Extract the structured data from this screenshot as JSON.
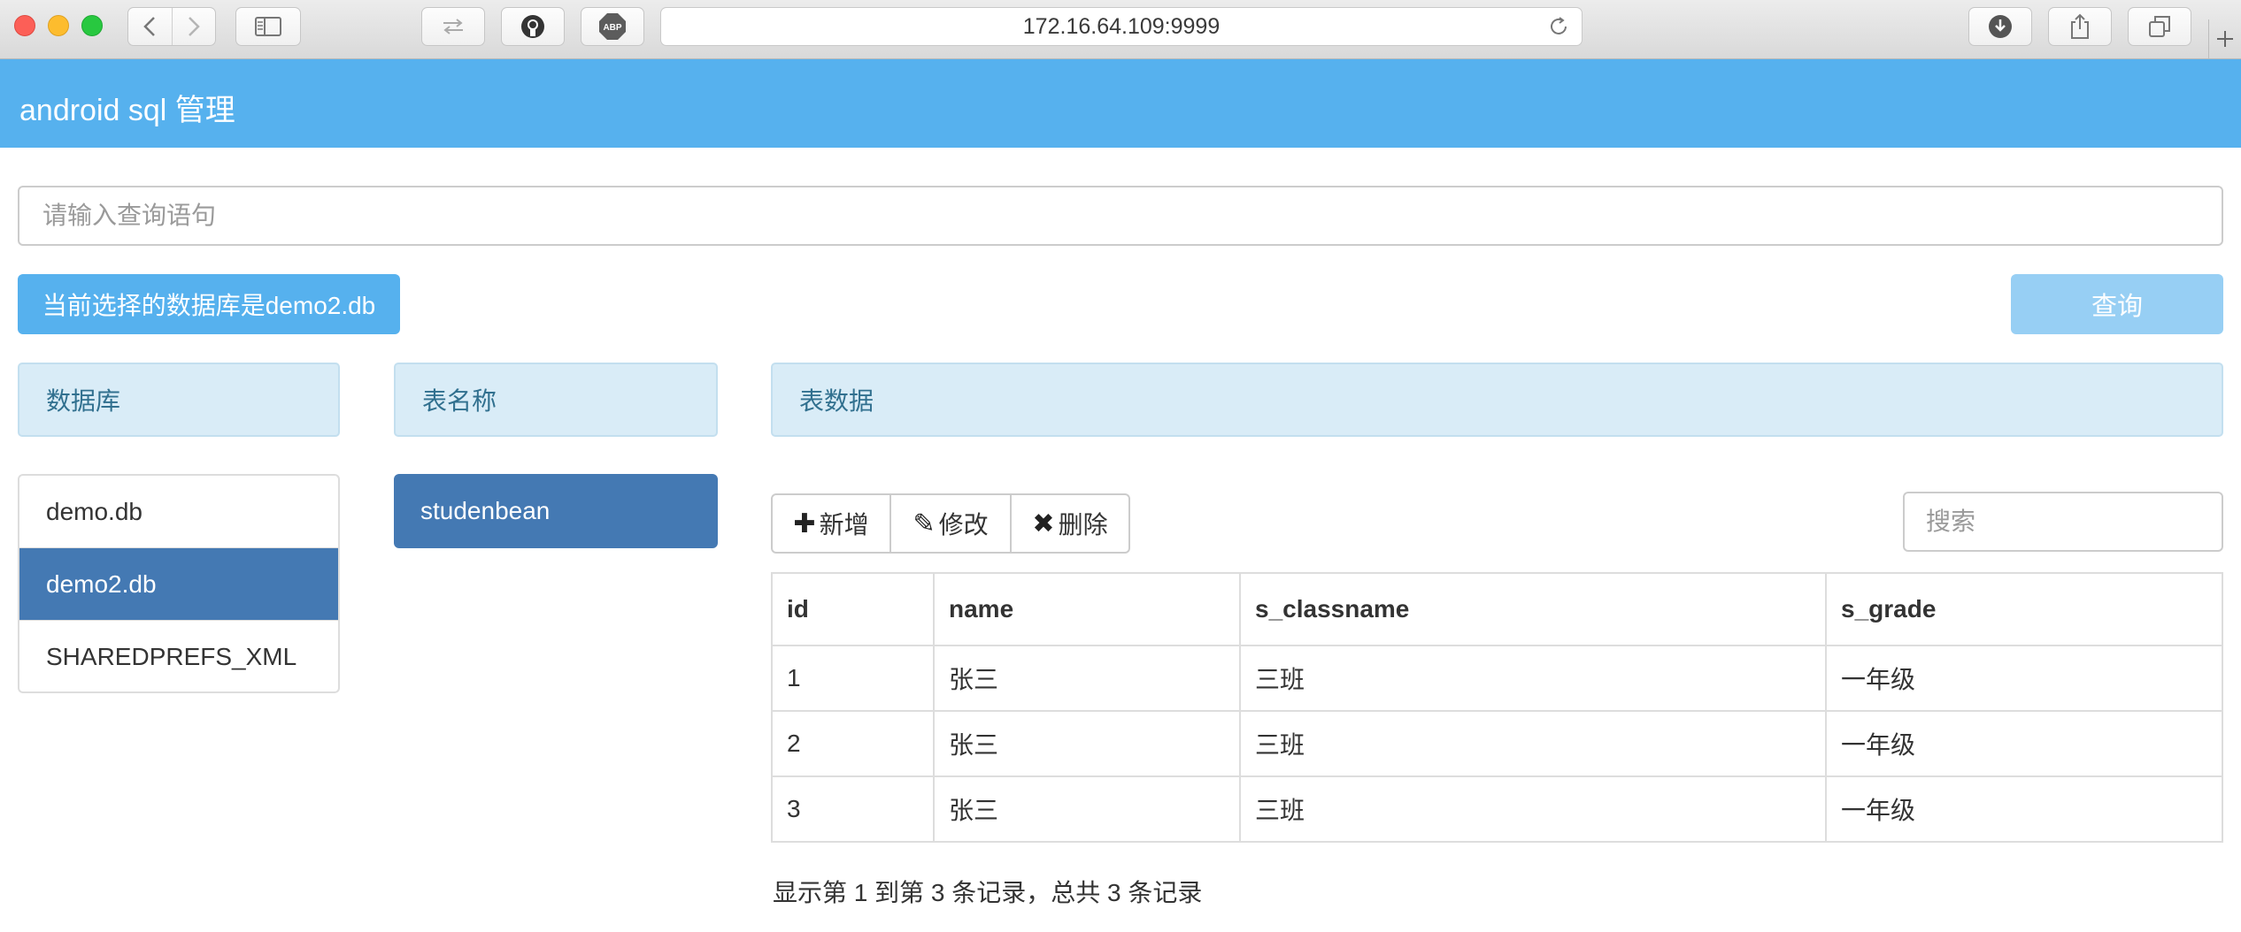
{
  "browser": {
    "url": "172.16.64.109:9999"
  },
  "app": {
    "title": "android sql 管理"
  },
  "query": {
    "placeholder": "请输入查询语句",
    "current_db_text": "当前选择的数据库是demo2.db",
    "button_label": "查询"
  },
  "panels": {
    "databases_header": "数据库",
    "tables_header": "表名称",
    "data_header": "表数据"
  },
  "databases": [
    {
      "name": "demo.db",
      "selected": false
    },
    {
      "name": "demo2.db",
      "selected": true
    },
    {
      "name": "SHAREDPREFS_XML",
      "selected": false
    }
  ],
  "tables": [
    {
      "name": "studenbean",
      "selected": true
    }
  ],
  "toolbar": {
    "add_label": "新增",
    "edit_label": "修改",
    "delete_label": "删除",
    "search_placeholder": "搜索"
  },
  "table": {
    "columns": [
      "id",
      "name",
      "s_classname",
      "s_grade"
    ],
    "rows": [
      [
        "1",
        "张三",
        "三班",
        "一年级"
      ],
      [
        "2",
        "张三",
        "三班",
        "一年级"
      ],
      [
        "3",
        "张三",
        "三班",
        "一年级"
      ]
    ]
  },
  "pagination": {
    "info": "显示第 1 到第 3 条记录，总共 3 条记录"
  },
  "colors": {
    "header_blue": "#56b1ee",
    "selected_blue": "#4479b3",
    "panel_head_bg": "#d9ecf7",
    "panel_head_text": "#31708f",
    "query_button_bg": "#97cff4"
  },
  "icons": {
    "add": "plus-icon",
    "edit": "pencil-icon",
    "delete": "x-icon"
  }
}
